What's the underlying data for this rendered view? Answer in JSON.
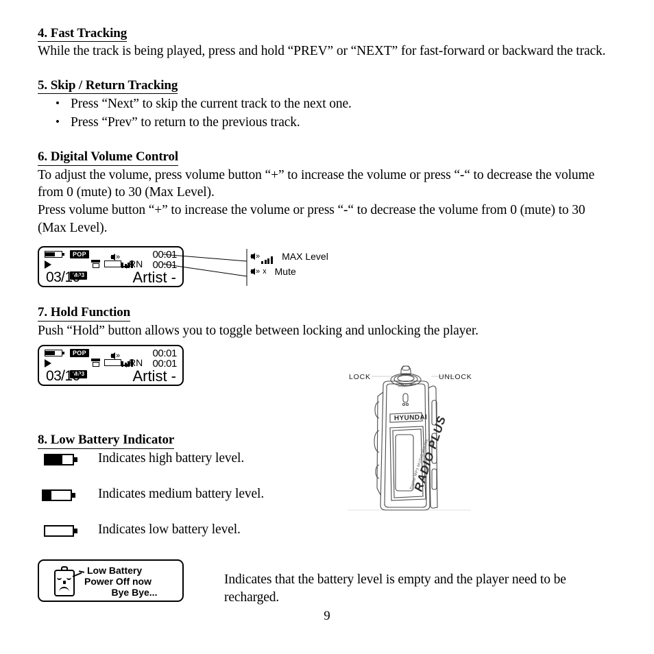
{
  "document": {
    "page_number": "9",
    "sections": [
      {
        "heading": "4. Fast Tracking",
        "paragraphs": [
          "While the track is being played, press and hold “PREV” or “NEXT” for fast-forward or backward the track."
        ]
      },
      {
        "heading": "5. Skip / Return Tracking",
        "bullets": [
          "Press “Next” to skip the current track to the next one.",
          "Press “Prev” to return to the previous track."
        ]
      },
      {
        "heading": "6. Digital Volume Control",
        "paragraphs": [
          "To adjust the volume, press volume button “+” to increase the volume or press “-“ to decrease the volume from 0 (mute) to 30 (Max Level).",
          "Press volume button “+” to increase the volume or press “-“ to decrease the volume from 0 (mute) to 30 (Max Level)."
        ]
      },
      {
        "heading": "7. Hold Function",
        "paragraphs": [
          "Push “Hold” button allows you to toggle between locking and unlocking the player."
        ]
      },
      {
        "heading": "8. Low Battery Indicator"
      }
    ]
  },
  "lcd_display": {
    "battery_icon": "battery-high-icon",
    "equalizer_tag": "POP",
    "format_tag": "MP3",
    "volume_icon": "speaker-icon",
    "volume_bars": 4,
    "time_top": "00:01",
    "time_bottom": "00:01",
    "play_icon": "play-icon",
    "folder_icon": "folder-icon",
    "repeat_label": "RN",
    "track_counter": "03/10",
    "artist_text": "Artist  -"
  },
  "volume_callouts": [
    {
      "icon": "speaker-max-icon",
      "label": "MAX Level"
    },
    {
      "icon": "speaker-mute-icon",
      "mark": "x",
      "label": "Mute"
    }
  ],
  "battery_levels": [
    {
      "icon": "battery-high-icon",
      "fill_percent": 62,
      "label": "Indicates high battery level."
    },
    {
      "icon": "battery-medium-icon",
      "fill_percent": 30,
      "label": "Indicates medium battery level."
    },
    {
      "icon": "battery-low-icon",
      "fill_percent": 0,
      "label": "Indicates low battery level."
    }
  ],
  "low_battery_box": {
    "icon": "sad-battery-character-icon",
    "line1": "Low Battery",
    "line2": "Power Off now",
    "line3": "Bye Bye...",
    "description": "Indicates that the battery level is empty and the player need to be recharged."
  },
  "device_illustration": {
    "lock_label": "LOCK",
    "unlock_label": "UNLOCK",
    "hold_label": "HOLD",
    "brand": "HYUNDAI",
    "product_text": "RADIO  PLUS",
    "feature_text": "Digital  MP3  MUSIC  PHONE"
  }
}
